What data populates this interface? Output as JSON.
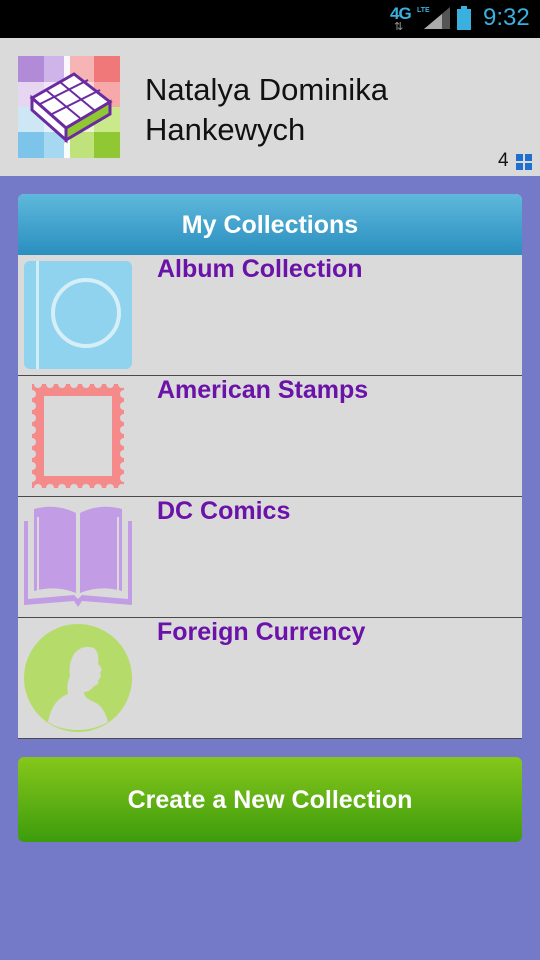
{
  "status_bar": {
    "network": "4G",
    "network_sub": "LTE",
    "time": "9:32"
  },
  "header": {
    "user_name": "Natalya Dominika Hankewych",
    "collection_count": "4"
  },
  "collections": {
    "title": "My Collections",
    "items": [
      {
        "label": "Album Collection",
        "icon": "album-icon"
      },
      {
        "label": "American Stamps",
        "icon": "stamp-icon"
      },
      {
        "label": "DC Comics",
        "icon": "open-book-icon"
      },
      {
        "label": "Foreign Currency",
        "icon": "coin-portrait-icon"
      }
    ]
  },
  "actions": {
    "create_label": "Create a New Collection"
  },
  "colors": {
    "background": "#7479c8",
    "header_bar": "#2a8fbf",
    "item_text": "#6b12a8",
    "create_button": "#5bb010"
  }
}
